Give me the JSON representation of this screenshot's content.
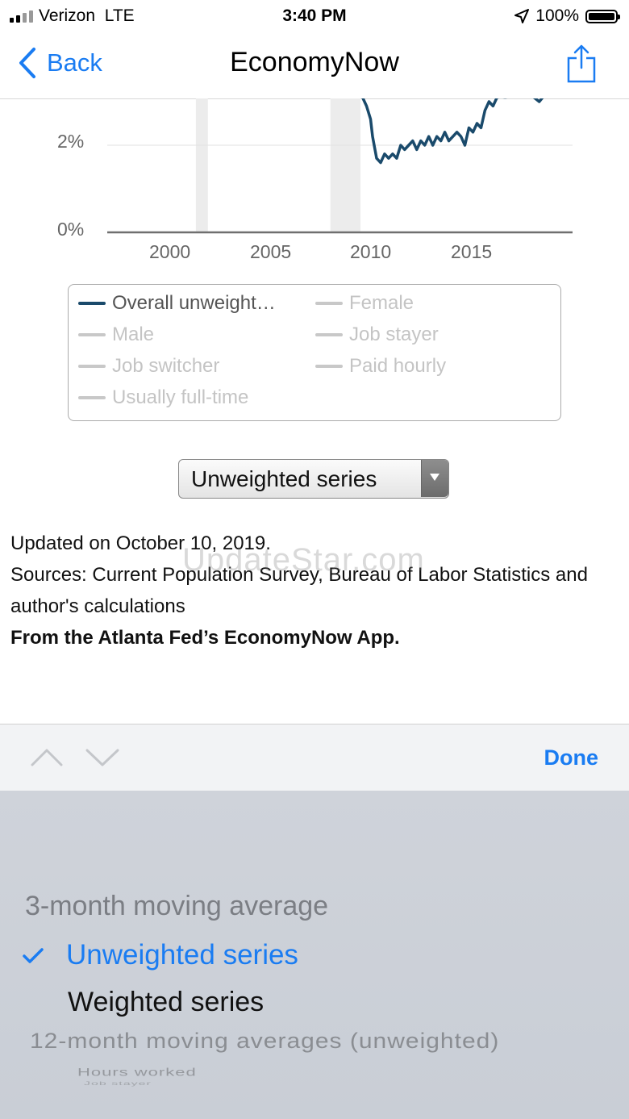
{
  "status_bar": {
    "carrier": "Verizon",
    "network": "LTE",
    "time": "3:40 PM",
    "battery": "100%"
  },
  "nav": {
    "back_label": "Back",
    "title": "EconomyNow"
  },
  "chart_data": {
    "type": "line",
    "ylabel": "",
    "xlabel": "",
    "y_ticks": [
      "0%",
      "2%"
    ],
    "x_ticks": [
      "2000",
      "2005",
      "2010",
      "2015"
    ],
    "recession_bands": [
      [
        2001.2,
        2001.8
      ],
      [
        2007.9,
        2009.4
      ]
    ],
    "series": [
      {
        "name": "Overall unweighted",
        "x": [
          2009.5,
          2009.7,
          2009.9,
          2010.0,
          2010.2,
          2010.4,
          2010.6,
          2010.8,
          2011.0,
          2011.2,
          2011.4,
          2011.6,
          2011.8,
          2012.0,
          2012.2,
          2012.4,
          2012.6,
          2012.8,
          2013.0,
          2013.2,
          2013.4,
          2013.6,
          2013.8,
          2014.0,
          2014.2,
          2014.4,
          2014.6,
          2014.8,
          2015.0,
          2015.2,
          2015.4,
          2015.6,
          2015.8,
          2016.0,
          2016.2,
          2016.4,
          2016.6,
          2016.8,
          2017.0,
          2017.5,
          2018.0,
          2018.3,
          2018.5,
          2018.7
        ],
        "y": [
          3.1,
          2.9,
          2.6,
          2.2,
          1.7,
          1.6,
          1.8,
          1.7,
          1.8,
          1.7,
          2.0,
          1.9,
          2.0,
          2.1,
          1.9,
          2.1,
          2.0,
          2.2,
          2.0,
          2.2,
          2.1,
          2.3,
          2.1,
          2.2,
          2.3,
          2.2,
          2.0,
          2.4,
          2.3,
          2.5,
          2.4,
          2.8,
          3.0,
          2.9,
          3.1,
          3.2,
          3.1,
          3.3,
          3.2,
          3.4,
          3.2,
          3.0,
          3.3,
          3.2
        ]
      }
    ],
    "legend": [
      "Overall unweight…",
      "Female",
      "Male",
      "Job stayer",
      "Job switcher",
      "Paid hourly",
      "Usually full-time"
    ]
  },
  "select": {
    "value": "Unweighted series"
  },
  "info": {
    "updated": "Updated on October 10, 2019.",
    "sources": "Sources: Current Population Survey, Bureau of Labor Statistics and author's calculations",
    "from": "From the Atlanta Fed’s EconomyNow App."
  },
  "watermark": "UpdateStar.com",
  "accessory": {
    "done_label": "Done"
  },
  "picker": {
    "options": [
      "3-month moving average",
      "Unweighted series",
      "Weighted series",
      "12-month moving averages (unweighted)",
      "Hours worked",
      "Job stayer"
    ],
    "selected": "Unweighted series"
  },
  "colors": {
    "accent": "#1a7cf2",
    "series": "#1a4a6b"
  }
}
